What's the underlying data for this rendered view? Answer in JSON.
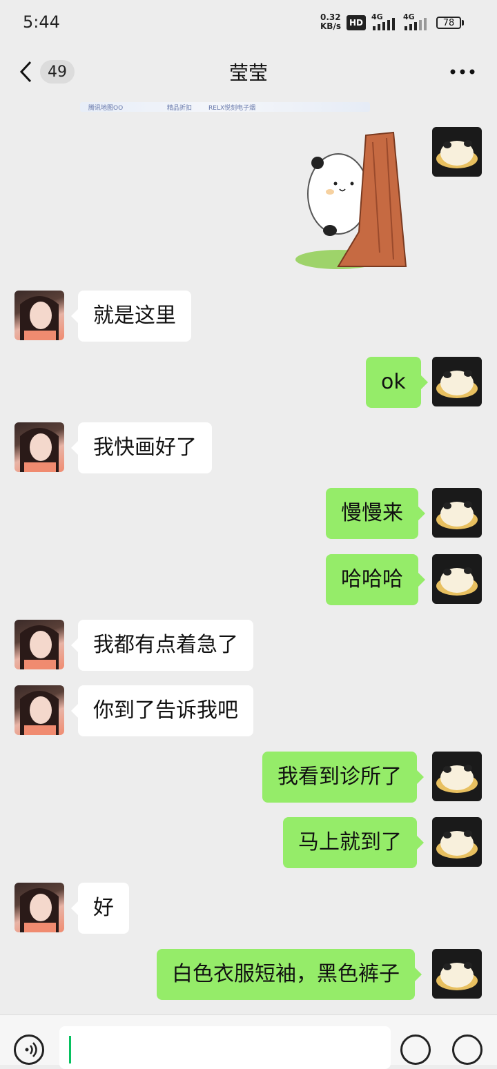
{
  "status_bar": {
    "time": "5:44",
    "net_speed_value": "0.32",
    "net_speed_unit": "KB/s",
    "hd_label": "HD",
    "signal_1": "4G",
    "signal_2": "4G",
    "battery": "78"
  },
  "header": {
    "back_icon": "chevron-left-icon",
    "unread_count": "49",
    "title": "莹莹",
    "more_icon": "more-dots-icon"
  },
  "pinned_strip": {
    "item_1": "腾讯地图OO",
    "item_2": "精品折扣",
    "item_3": "RELX悦刻电子烟"
  },
  "messages": [
    {
      "from": "me",
      "type": "sticker",
      "sticker_name": "panda-peeking-behind-tree-sticker"
    },
    {
      "from": "her",
      "text": "就是这里"
    },
    {
      "from": "me",
      "text": "ok"
    },
    {
      "from": "her",
      "text": "我快画好了"
    },
    {
      "from": "me",
      "text": "慢慢来"
    },
    {
      "from": "me",
      "text": "哈哈哈"
    },
    {
      "from": "her",
      "text": "我都有点着急了"
    },
    {
      "from": "her",
      "text": "你到了告诉我吧"
    },
    {
      "from": "me",
      "text": "我看到诊所了"
    },
    {
      "from": "me",
      "text": "马上就到了"
    },
    {
      "from": "her",
      "text": "好"
    },
    {
      "from": "me",
      "text": "白色衣服短袖，黑色裤子"
    }
  ],
  "input_bar": {
    "voice_icon": "voice-icon",
    "input_value": "",
    "emoji_icon": "emoji-icon",
    "plus_icon": "plus-icon"
  },
  "colors": {
    "background": "#ededed",
    "outgoing_bubble": "#95ec69",
    "incoming_bubble": "#ffffff",
    "cursor": "#07c160"
  }
}
